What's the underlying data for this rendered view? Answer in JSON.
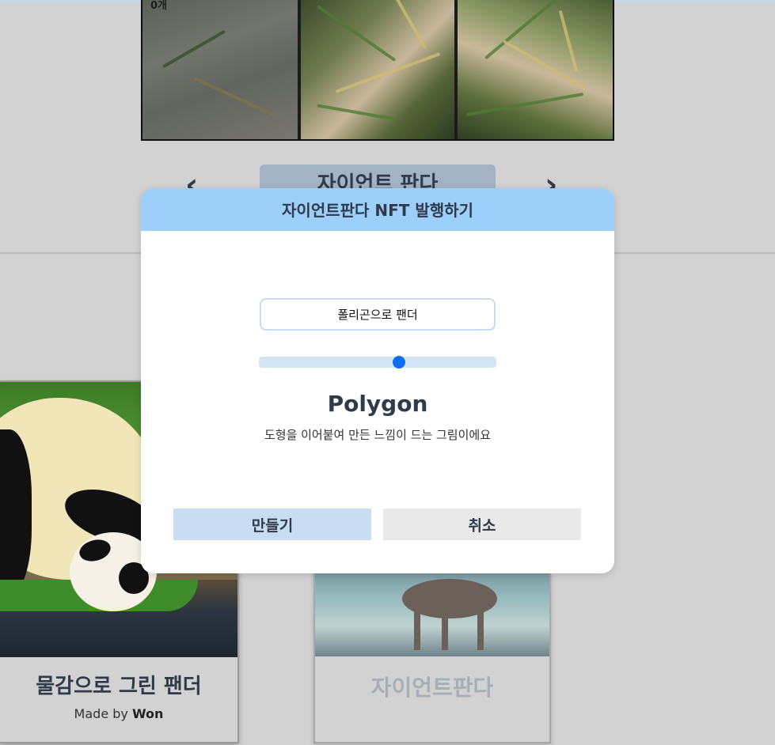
{
  "gallery": {
    "strip_label": "0개",
    "title": "자이언트 판다"
  },
  "cards": [
    {
      "title": "물감으로 그린 팬더",
      "made_by_label": "Made by",
      "author": "Won"
    },
    {
      "title": "자이언트판다"
    }
  ],
  "modal": {
    "title": "자이언트판다 NFT 발행하기",
    "name_input_value": "폴리곤으로 팬더",
    "slider_value": 0.59,
    "style_name": "Polygon",
    "style_description": "도형을 이어붙여 만든 느낌이 드는 그림이에요",
    "create_label": "만들기",
    "cancel_label": "취소"
  },
  "colors": {
    "modal_header": "#9ccffa",
    "slider_thumb": "#0b6ff0",
    "create_button": "#c9ddf2",
    "cancel_button": "#e9e9e9"
  },
  "icons": {
    "prev": "chevron-left-icon",
    "next": "chevron-right-icon"
  }
}
